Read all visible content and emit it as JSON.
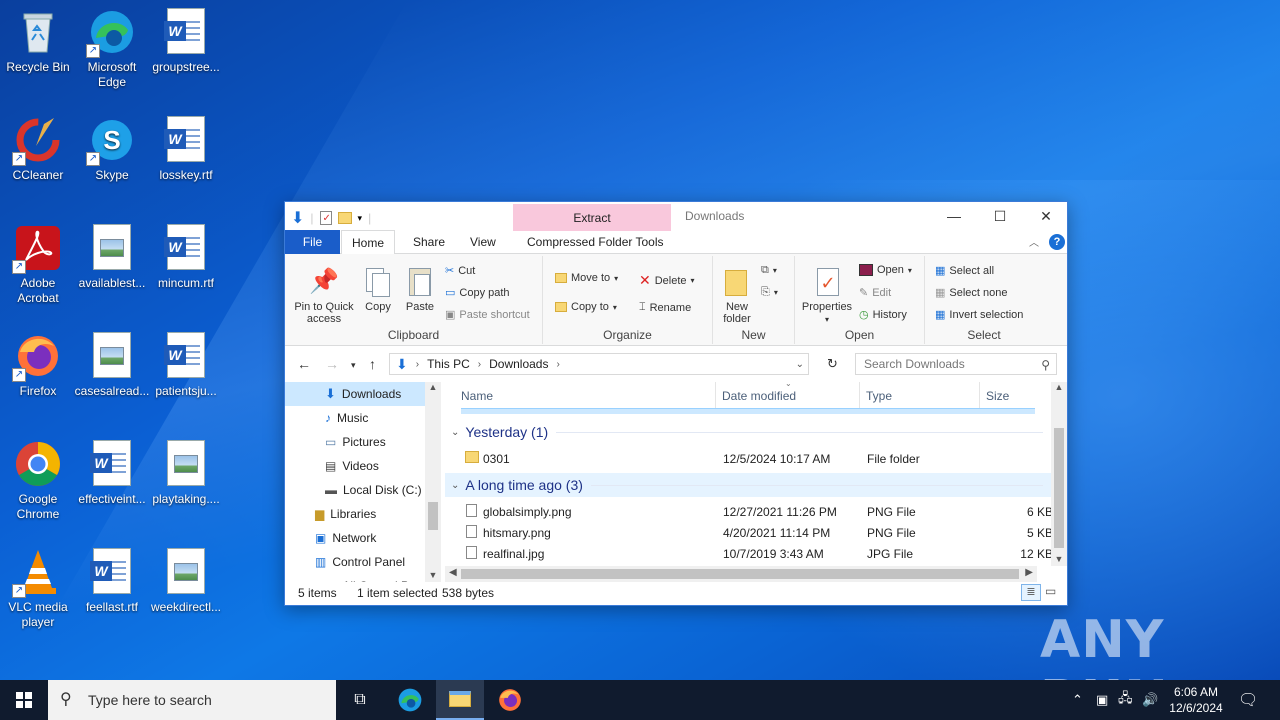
{
  "desktop": {
    "icons": [
      {
        "label": "Recycle Bin"
      },
      {
        "label": "Microsoft Edge"
      },
      {
        "label": "groupstree..."
      },
      {
        "label": "CCleaner"
      },
      {
        "label": "Skype"
      },
      {
        "label": "losskey.rtf"
      },
      {
        "label": "Adobe Acrobat"
      },
      {
        "label": "availablest..."
      },
      {
        "label": "mincum.rtf"
      },
      {
        "label": "Firefox"
      },
      {
        "label": "casesalread..."
      },
      {
        "label": "patientsju..."
      },
      {
        "label": "Google Chrome"
      },
      {
        "label": "effectiveint..."
      },
      {
        "label": "playtaking...."
      },
      {
        "label": "VLC media player"
      },
      {
        "label": "feellast.rtf"
      },
      {
        "label": "weekdirectl..."
      }
    ]
  },
  "explorer": {
    "title": "Downloads",
    "context_tab": "Extract",
    "tabs": [
      "File",
      "Home",
      "Share",
      "View",
      "Compressed Folder Tools"
    ],
    "ribbon": {
      "clipboard": {
        "label": "Clipboard",
        "pin": "Pin to Quick access",
        "copy": "Copy",
        "paste": "Paste",
        "cut": "Cut",
        "copy_path": "Copy path",
        "paste_shortcut": "Paste shortcut"
      },
      "organize": {
        "label": "Organize",
        "move_to": "Move to",
        "copy_to": "Copy to",
        "delete": "Delete",
        "rename": "Rename"
      },
      "new": {
        "label": "New",
        "new_folder": "New folder"
      },
      "open": {
        "label": "Open",
        "properties": "Properties",
        "open": "Open",
        "edit": "Edit",
        "history": "History"
      },
      "select": {
        "label": "Select",
        "select_all": "Select all",
        "select_none": "Select none",
        "invert": "Invert selection"
      }
    },
    "address": {
      "crumbs": [
        "This PC",
        "Downloads"
      ],
      "search_placeholder": "Search Downloads"
    },
    "nav": [
      "Downloads",
      "Music",
      "Pictures",
      "Videos",
      "Local Disk (C:)",
      "Libraries",
      "Network",
      "Control Panel",
      "All Control P..."
    ],
    "columns": {
      "name": "Name",
      "date": "Date modified",
      "type": "Type",
      "size": "Size"
    },
    "groups": [
      {
        "title": "Yesterday (1)",
        "rows": [
          {
            "name": "0301",
            "date": "12/5/2024 10:17 AM",
            "type": "File folder",
            "size": ""
          }
        ]
      },
      {
        "title": "A long time ago (3)",
        "rows": [
          {
            "name": "globalsimply.png",
            "date": "12/27/2021 11:26 PM",
            "type": "PNG File",
            "size": "6 KB"
          },
          {
            "name": "hitsmary.png",
            "date": "4/20/2021 11:14 PM",
            "type": "PNG File",
            "size": "5 KB"
          },
          {
            "name": "realfinal.jpg",
            "date": "10/7/2019 3:43 AM",
            "type": "JPG File",
            "size": "12 KB"
          }
        ]
      }
    ],
    "status": {
      "items": "5 items",
      "selected": "1 item selected",
      "bytes": "538 bytes"
    }
  },
  "taskbar": {
    "search_placeholder": "Type here to search",
    "time": "6:06 AM",
    "date": "12/6/2024"
  },
  "watermark": "ANY RUN"
}
